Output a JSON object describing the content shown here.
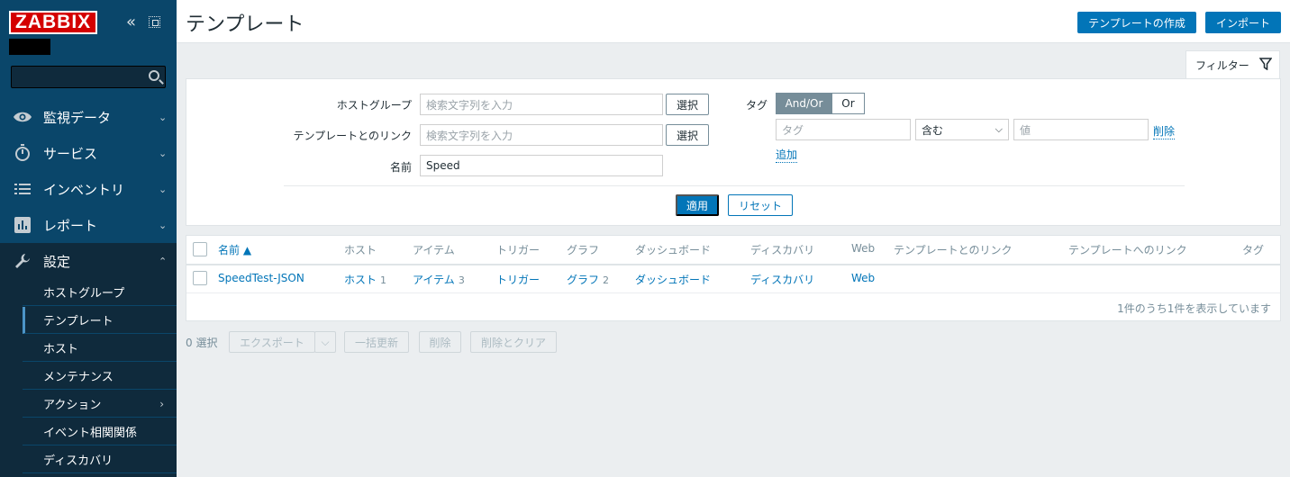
{
  "app": {
    "logo": "ZABBIX"
  },
  "sidebar": {
    "items": [
      {
        "label": "監視データ",
        "icon": "eye-icon"
      },
      {
        "label": "サービス",
        "icon": "stopwatch-icon"
      },
      {
        "label": "インベントリ",
        "icon": "list-icon"
      },
      {
        "label": "レポート",
        "icon": "bar-chart-icon"
      },
      {
        "label": "設定",
        "icon": "wrench-icon"
      }
    ],
    "submenu": [
      {
        "label": "ホストグループ"
      },
      {
        "label": "テンプレート"
      },
      {
        "label": "ホスト"
      },
      {
        "label": "メンテナンス"
      },
      {
        "label": "アクション"
      },
      {
        "label": "イベント相関関係"
      },
      {
        "label": "ディスカバリ"
      }
    ]
  },
  "header": {
    "title": "テンプレート",
    "create_label": "テンプレートの作成",
    "import_label": "インポート"
  },
  "filter": {
    "tab_label": "フィルター",
    "hostgroup_label": "ホストグループ",
    "hostgroup_placeholder": "検索文字列を入力",
    "linked_label": "テンプレートとのリンク",
    "linked_placeholder": "検索文字列を入力",
    "select_label": "選択",
    "name_label": "名前",
    "name_value": "Speed",
    "tag_label": "タグ",
    "andor_label": "And/Or",
    "or_label": "Or",
    "tag_placeholder": "タグ",
    "operator_value": "含む",
    "value_placeholder": "値",
    "remove_label": "削除",
    "add_label": "追加",
    "apply_label": "適用",
    "reset_label": "リセット"
  },
  "table": {
    "headers": {
      "name": "名前 ▲",
      "hosts": "ホスト",
      "items": "アイテム",
      "triggers": "トリガー",
      "graphs": "グラフ",
      "dashboards": "ダッシュボード",
      "discovery": "ディスカバリ",
      "web": "Web",
      "linked": "テンプレートとのリンク",
      "linked_to": "テンプレートへのリンク",
      "tags": "タグ"
    },
    "rows": [
      {
        "name": "SpeedTest-JSON",
        "hosts": "ホスト",
        "hosts_count": "1",
        "items": "アイテム",
        "items_count": "3",
        "triggers": "トリガー",
        "graphs": "グラフ",
        "graphs_count": "2",
        "dashboards": "ダッシュボード",
        "discovery": "ディスカバリ",
        "web": "Web"
      }
    ],
    "paging": "1件のうち1件を表示しています"
  },
  "actions": {
    "selected": "0 選択",
    "export": "エクスポート",
    "mass_update": "一括更新",
    "delete": "削除",
    "delete_clear": "削除とクリア"
  },
  "colors": {
    "sidebar_bg": "#0a466a",
    "sidebar_dark": "#0f2a3c",
    "accent": "#0275b8",
    "logo_red": "#d40000"
  }
}
